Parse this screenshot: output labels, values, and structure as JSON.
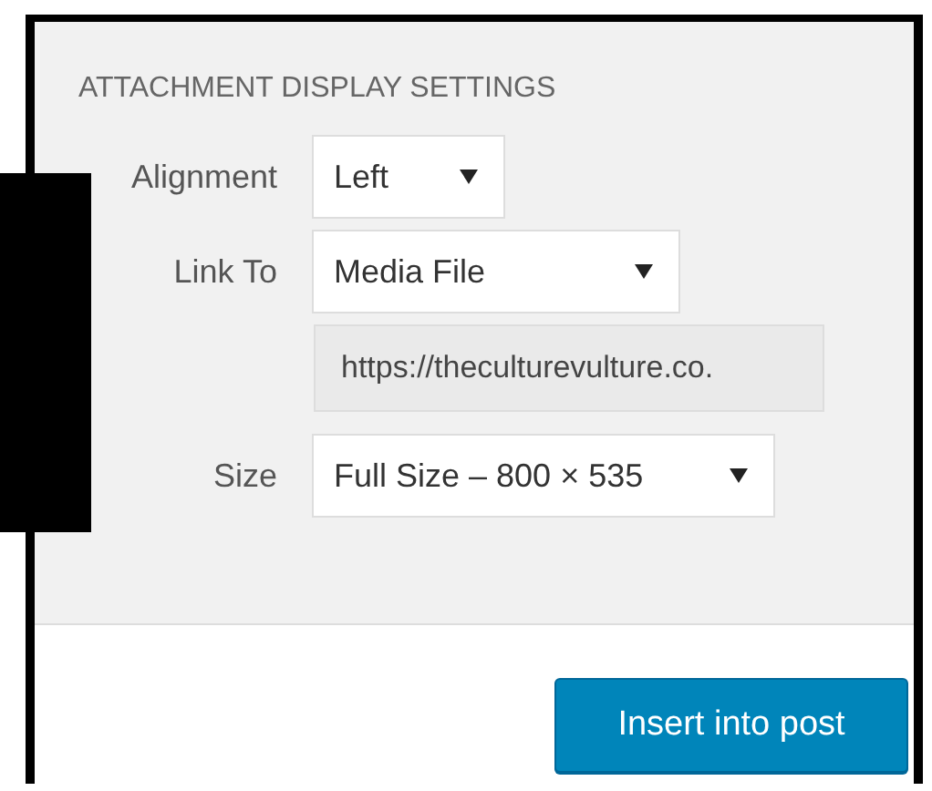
{
  "section": {
    "heading": "ATTACHMENT DISPLAY SETTINGS",
    "fields": [
      {
        "kind": "select",
        "label": "Alignment",
        "value": "Left"
      },
      {
        "kind": "select",
        "label": "Link To",
        "value": "Media File"
      },
      {
        "kind": "readonly",
        "value": "https://theculturevulture.co."
      },
      {
        "kind": "select",
        "label": "Size",
        "value": "Full Size – 800 × 535"
      }
    ]
  },
  "footer": {
    "button": "Insert into post"
  }
}
